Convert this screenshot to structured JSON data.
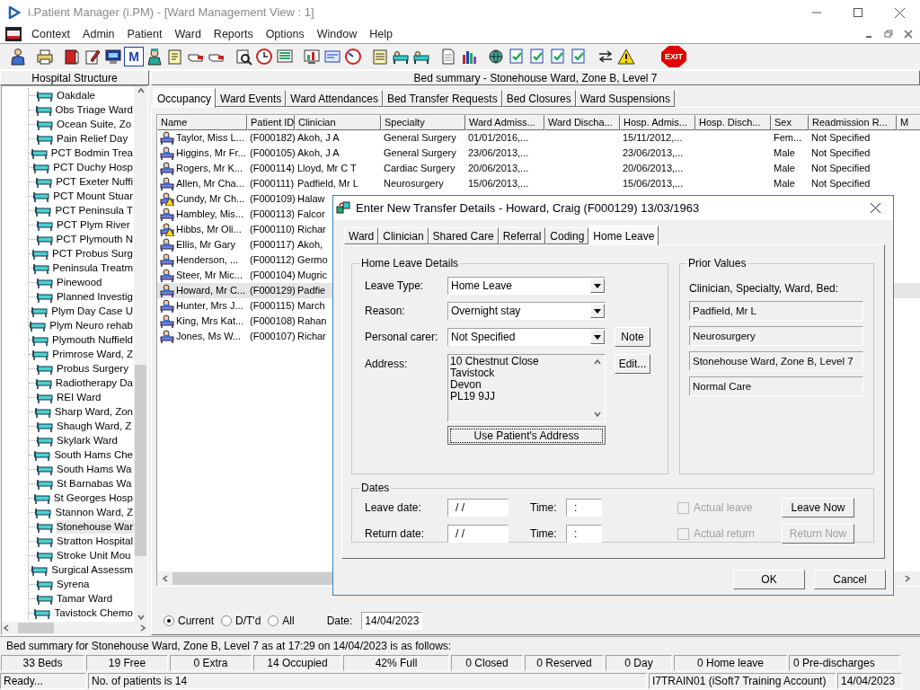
{
  "window": {
    "title": "i.Patient Manager (i.PM) - [Ward Management View : 1]"
  },
  "menu": [
    "Context",
    "Admin",
    "Patient",
    "Ward",
    "Reports",
    "Options",
    "Window",
    "Help"
  ],
  "toolbar": {
    "letter_icon": "M",
    "exit_label": "EXIT"
  },
  "left_panel": {
    "title": "Hospital Structure",
    "items": [
      {
        "label": "Oakdale",
        "selected": false
      },
      {
        "label": "Obs Triage Ward",
        "selected": false
      },
      {
        "label": "Ocean Suite, Zo",
        "selected": false
      },
      {
        "label": "Pain Relief Day",
        "selected": false
      },
      {
        "label": "PCT Bodmin Trea",
        "selected": false
      },
      {
        "label": "PCT Duchy Hosp",
        "selected": false
      },
      {
        "label": "PCT Exeter Nuffi",
        "selected": false
      },
      {
        "label": "PCT Mount Stuar",
        "selected": false
      },
      {
        "label": "PCT Peninsula T",
        "selected": false
      },
      {
        "label": "PCT Plym River",
        "selected": false
      },
      {
        "label": "PCT Plymouth N",
        "selected": false
      },
      {
        "label": "PCT Probus Surg",
        "selected": false
      },
      {
        "label": "Peninsula Treatm",
        "selected": false
      },
      {
        "label": "Pinewood",
        "selected": false
      },
      {
        "label": "Planned Investig",
        "selected": false
      },
      {
        "label": "Plym Day Case U",
        "selected": false
      },
      {
        "label": "Plym Neuro rehab",
        "selected": false
      },
      {
        "label": "Plymouth Nuffield",
        "selected": false
      },
      {
        "label": "Primrose Ward, Z",
        "selected": false
      },
      {
        "label": "Probus Surgery",
        "selected": false
      },
      {
        "label": "Radiotherapy Da",
        "selected": false
      },
      {
        "label": "REI Ward",
        "selected": false
      },
      {
        "label": "Sharp Ward, Zon",
        "selected": false
      },
      {
        "label": "Shaugh Ward, Z",
        "selected": false
      },
      {
        "label": "Skylark Ward",
        "selected": false
      },
      {
        "label": "South Hams Che",
        "selected": false
      },
      {
        "label": "South Hams Wa",
        "selected": false
      },
      {
        "label": "St Barnabas Wa",
        "selected": false
      },
      {
        "label": "St Georges Hosp",
        "selected": false
      },
      {
        "label": "Stannon Ward, Z",
        "selected": false
      },
      {
        "label": "Stonehouse War",
        "selected": true
      },
      {
        "label": "Stratton Hospital",
        "selected": false
      },
      {
        "label": "Stroke Unit Mou",
        "selected": false
      },
      {
        "label": "Surgical Assessm",
        "selected": false
      },
      {
        "label": "Syrena",
        "selected": false
      },
      {
        "label": "Tamar Ward",
        "selected": false
      },
      {
        "label": "Tavistock Chemo",
        "selected": false
      }
    ]
  },
  "main": {
    "title": "Bed summary - Stonehouse Ward, Zone B, Level 7",
    "tabs": [
      {
        "label": "Occupancy",
        "selected": true
      },
      {
        "label": "Ward Events",
        "selected": false
      },
      {
        "label": "Ward Attendances",
        "selected": false
      },
      {
        "label": "Bed Transfer Requests",
        "selected": false
      },
      {
        "label": "Bed Closures",
        "selected": false
      },
      {
        "label": "Ward Suspensions",
        "selected": false
      }
    ],
    "table": {
      "columns": [
        "Name",
        "Patient ID",
        "Clinician",
        "Specialty",
        "Ward Admiss...",
        "Ward Discha...",
        "Hosp. Admis...",
        "Hosp. Disch...",
        "Sex",
        "Readmission R...",
        "M"
      ],
      "rows": [
        {
          "name": "Taylor, Miss L...",
          "patient_id": "(F000182)",
          "clinician": "Akoh, J A",
          "specialty": "General Surgery",
          "ward_admission": "01/01/2016,...",
          "hosp_admission": "15/11/2012,...",
          "sex": "Fem...",
          "readmission": "Not Specified",
          "alert": false,
          "selected": false
        },
        {
          "name": "Higgins, Mr Fr...",
          "patient_id": "(F000105)",
          "clinician": "Akoh, J A",
          "specialty": "General Surgery",
          "ward_admission": "23/06/2013,...",
          "hosp_admission": "23/06/2013,...",
          "sex": "Male",
          "readmission": "Not Specified",
          "alert": false,
          "selected": false
        },
        {
          "name": "Rogers, Mr K...",
          "patient_id": "(F000114)",
          "clinician": "Lloyd, Mr C T",
          "specialty": "Cardiac Surgery",
          "ward_admission": "20/06/2013,...",
          "hosp_admission": "20/06/2013,...",
          "sex": "Male",
          "readmission": "Not Specified",
          "alert": false,
          "selected": false
        },
        {
          "name": "Allen, Mr Cha...",
          "patient_id": "(F000111)",
          "clinician": "Padfield, Mr L",
          "specialty": "Neurosurgery",
          "ward_admission": "15/06/2013,...",
          "hosp_admission": "15/06/2013,...",
          "sex": "Male",
          "readmission": "Not Specified",
          "alert": false,
          "selected": false
        },
        {
          "name": "Cundy, Mr Ch...",
          "patient_id": "(F000109)",
          "clinician": "Halaw",
          "alert": true,
          "selected": false
        },
        {
          "name": "Hambley, Mis...",
          "patient_id": "(F000113)",
          "clinician": "Falcor",
          "alert": false,
          "selected": false
        },
        {
          "name": "Hibbs, Mr Oli...",
          "patient_id": "(F000110)",
          "clinician": "Richar",
          "alert": true,
          "selected": false
        },
        {
          "name": "Ellis, Mr Gary",
          "patient_id": "(F000117)",
          "clinician": "Akoh,",
          "alert": false,
          "selected": false
        },
        {
          "name": "Henderson, ...",
          "patient_id": "(F000112)",
          "clinician": "Germo",
          "alert": false,
          "selected": false
        },
        {
          "name": "Steer, Mr Mic...",
          "patient_id": "(F000104)",
          "clinician": "Mugric",
          "alert": false,
          "selected": false
        },
        {
          "name": "Howard, Mr C...",
          "patient_id": "(F000129)",
          "clinician": "Padfie",
          "alert": false,
          "selected": true
        },
        {
          "name": "Hunter, Mrs J...",
          "patient_id": "(F000115)",
          "clinician": "March",
          "alert": false,
          "selected": false
        },
        {
          "name": "King, Mrs Kat...",
          "patient_id": "(F000108)",
          "clinician": "Rahan",
          "alert": false,
          "selected": false
        },
        {
          "name": "Jones, Ms W...",
          "patient_id": "(F000107)",
          "clinician": "Richar",
          "alert": false,
          "selected": false
        }
      ]
    },
    "filter": [
      {
        "label": "Current",
        "selected": true
      },
      {
        "label": "D/T'd",
        "selected": false
      },
      {
        "label": "All",
        "selected": false
      }
    ],
    "date": {
      "label": "Date:",
      "value": "14/04/2023"
    }
  },
  "dialog": {
    "title": "Enter New Transfer Details - Howard, Craig (F000129) 13/03/1963",
    "tabs": [
      {
        "label": "Ward",
        "selected": false
      },
      {
        "label": "Clinician",
        "selected": false
      },
      {
        "label": "Shared Care",
        "selected": false
      },
      {
        "label": "Referral",
        "selected": false
      },
      {
        "label": "Coding",
        "selected": false
      },
      {
        "label": "Home Leave",
        "selected": true
      }
    ],
    "details": {
      "title": "Home Leave Details",
      "dropdowns": [
        {
          "label": "Leave Type:",
          "value": "Home Leave"
        },
        {
          "label": "Reason:",
          "value": "Overnight stay"
        },
        {
          "label": "Personal carer:",
          "value": "Not Specified",
          "button": "Note"
        }
      ],
      "address": {
        "label": "Address:",
        "lines": [
          "10 Chestnut Close",
          "Tavistock",
          "Devon",
          "PL19 9JJ"
        ],
        "button": "Edit..."
      },
      "use_address_button": "Use Patient's Address"
    },
    "prior": {
      "title": "Prior Values",
      "label": "Clinician, Specialty, Ward, Bed:",
      "values": [
        "Padfield, Mr L",
        "Neurosurgery",
        "Stonehouse Ward, Zone B, Level 7",
        "Normal Care"
      ]
    },
    "dates": {
      "title": "Dates",
      "rows": [
        {
          "label": "Leave date:",
          "date": "/ /",
          "time_label": "Time:",
          "time": ":",
          "check_label": "Actual leave",
          "checked": false,
          "disabled": true,
          "button": "Leave Now",
          "button_disabled": false
        },
        {
          "label": "Return date:",
          "date": "/ /",
          "time_label": "Time:",
          "time": ":",
          "check_label": "Actual return",
          "checked": false,
          "disabled": true,
          "button": "Return Now",
          "button_disabled": true
        }
      ]
    },
    "buttons": [
      "OK",
      "Cancel"
    ]
  },
  "summary": "Bed summary for Stonehouse Ward, Zone B, Level 7 as at 17:29 on 14/04/2023 is as follows:",
  "stats": [
    "33 Beds",
    "19 Free",
    "0 Extra",
    "14 Occupied",
    "42% Full",
    "0 Closed",
    "0 Reserved",
    "0 Day",
    "0 Home leave",
    "0 Pre-discharges"
  ],
  "status_bar": [
    "Ready...",
    "No. of patients is 14",
    "I7TRAIN01 (iSoft7 Training Account)",
    "14/04/2023"
  ]
}
